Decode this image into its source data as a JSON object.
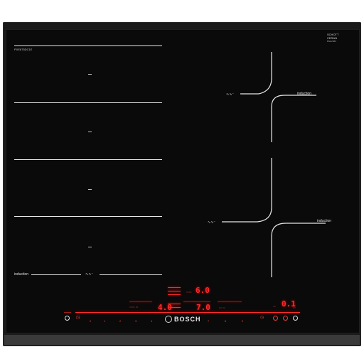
{
  "product": {
    "model": "PXE875DC1E",
    "ceran_line1": "SCHOTT",
    "ceran_line2": "CERAN",
    "ceran_line3": "BSH2080",
    "brand": "BOSCH"
  },
  "zones": {
    "left_label": "induction",
    "right_top_label": "induction",
    "right_bottom_label": "induction"
  },
  "display": {
    "timer_top": "6.0",
    "timer_mid": "7.0",
    "power_left": "4.0",
    "clock_right": "0.1",
    "slider_numbers": [
      "0",
      "1",
      "2",
      "3",
      "4",
      "5",
      "6",
      "7",
      "8",
      "9"
    ]
  },
  "colors": {
    "glass": "#0a0a0a",
    "frame": "#1a1a1a",
    "display_red": "#ff2a2a"
  },
  "icons": [
    "power-icon",
    "flex-zone-icon",
    "timer-icon",
    "lock-icon"
  ]
}
